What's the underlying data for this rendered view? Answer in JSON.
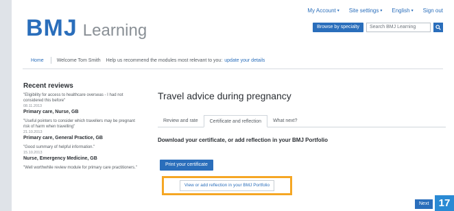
{
  "header": {
    "logo_bmj": "BMJ",
    "logo_learning": "Learning",
    "links": [
      "My Account",
      "Site settings",
      "English",
      "Sign out"
    ],
    "browse_button": "Browse by specialty",
    "search_placeholder": "Search BMJ Learning"
  },
  "welcome": {
    "home": "Home",
    "greeting": "Welcome Tom Smith",
    "prompt": "Help us recommend the modules most relevant to you:",
    "update_link": "update your details"
  },
  "reviews": {
    "title": "Recent reviews",
    "items": [
      {
        "quote": "\"Eligibility for access to healthcare overseas - I had not considered this before\"",
        "date": "08.11.2013",
        "author": "Primary care, Nurse, GB"
      },
      {
        "quote": "\"Useful pointers to consider which travellers may be pregnant risk of harm when travelling\"",
        "date": "21.10.2013",
        "author": "Primary care, General Practice, GB"
      },
      {
        "quote": "\"Good summary of helpful information.\"",
        "date": "15.10.2013",
        "author": "Nurse, Emergency Medicine, GB"
      },
      {
        "quote": "\"Well worthwhile review module for primary care practitioners.\"",
        "date": "",
        "author": ""
      }
    ]
  },
  "main": {
    "title": "Travel advice during pregnancy",
    "tabs": [
      "Review and rate",
      "Certificate and reflection",
      "What next?"
    ],
    "download_heading": "Download your certificate, or add reflection in your BMJ Portfolio",
    "print_button": "Print your certificate",
    "reflection_button": "View or add reflection in your BMJ Portfolio",
    "next_button": "Next"
  },
  "page_number": "17",
  "colors": {
    "brand_blue": "#2a6ebb",
    "highlight_orange": "#f5a623",
    "badge_blue": "#2a8ad4"
  }
}
